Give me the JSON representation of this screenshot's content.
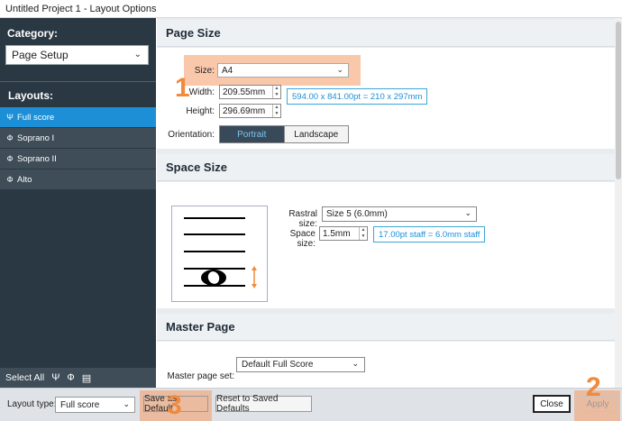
{
  "window": {
    "title": "Untitled Project 1 - Layout Options"
  },
  "sidebar": {
    "category_label": "Category:",
    "category_value": "Page Setup",
    "layouts_label": "Layouts:",
    "layouts": [
      {
        "label": "Full score",
        "icon": "full-score-icon",
        "selected": true
      },
      {
        "label": "Soprano I",
        "icon": "part-icon",
        "selected": false
      },
      {
        "label": "Soprano II",
        "icon": "part-icon",
        "selected": false
      },
      {
        "label": "Alto",
        "icon": "part-icon",
        "selected": false
      }
    ],
    "select_all_label": "Select All"
  },
  "page_size": {
    "heading": "Page Size",
    "size_label": "Size:",
    "size_value": "A4",
    "width_label": "Width:",
    "width_value": "209.55mm",
    "height_label": "Height:",
    "height_value": "296.69mm",
    "dimension_info": "594.00 x 841.00pt = 210 x 297mm",
    "orientation_label": "Orientation:",
    "orientation_options": [
      "Portrait",
      "Landscape"
    ],
    "orientation_selected": "Portrait"
  },
  "space_size": {
    "heading": "Space Size",
    "rastral_label": "Rastral size:",
    "rastral_value": "Size 5 (6.0mm)",
    "space_label": "Space size:",
    "space_value": "1.5mm",
    "space_info": "17.00pt staff = 6.0mm staff"
  },
  "master_page": {
    "heading": "Master Page",
    "set_label": "Master page set:",
    "set_value": "Default Full Score"
  },
  "bottom": {
    "layout_type_label": "Layout type:",
    "layout_type_value": "Full score",
    "save_default_label": "Save as Default",
    "reset_label": "Reset to Saved Defaults",
    "close_label": "Close",
    "apply_label": "Apply"
  },
  "annotations": [
    "1",
    "2",
    "3"
  ],
  "colors": {
    "sidebar_bg": "#2a3844",
    "selected_item": "#1c8fd6",
    "highlight": "#f49a66",
    "annotation_number": "#f08a3c",
    "info_text": "#1c8fd6"
  }
}
